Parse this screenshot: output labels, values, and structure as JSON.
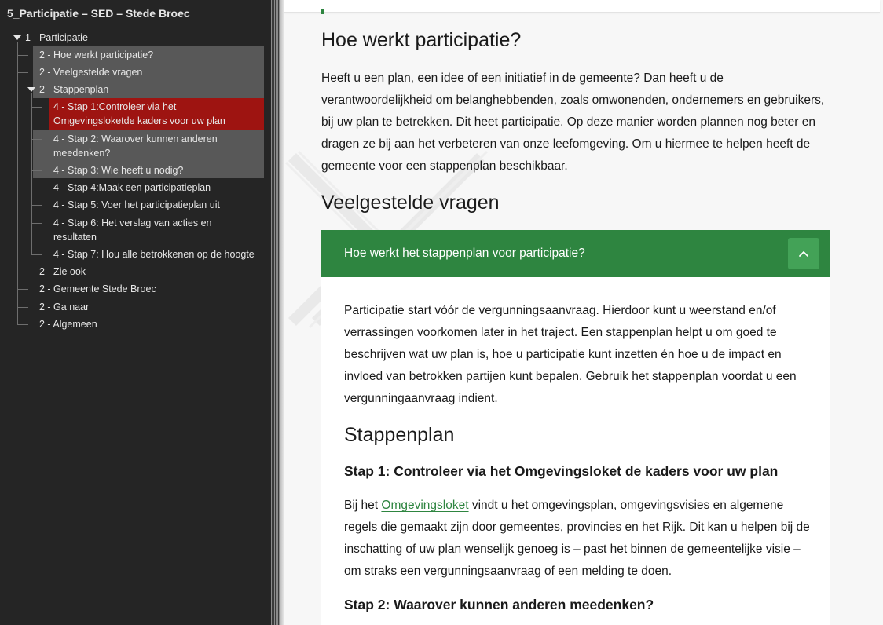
{
  "sidebar": {
    "title": "5_Participatie – SED – Stede Broec",
    "items": [
      {
        "label": "1 - Participatie"
      },
      {
        "label": "2 - Hoe werkt participatie?"
      },
      {
        "label": "2 - Veelgestelde vragen"
      },
      {
        "label": "2 - Stappenplan"
      },
      {
        "label": "4 - Stap 1:Controleer via het Omgevingsloketde kaders voor uw plan"
      },
      {
        "label": "4 - Stap 2: Waarover kunnen anderen meedenken?"
      },
      {
        "label": "4 - Stap 3: Wie heeft u nodig?"
      },
      {
        "label": "4 - Stap 4:Maak een participatieplan"
      },
      {
        "label": "4 - Stap 5: Voer het participatieplan uit"
      },
      {
        "label": "4 - Stap 6: Het verslag van acties en resultaten"
      },
      {
        "label": "4 - Stap 7: Hou alle betrokkenen op de hoogte"
      },
      {
        "label": "2 - Zie ook"
      },
      {
        "label": "2 - Gemeente Stede Broec"
      },
      {
        "label": "2 - Ga naar"
      },
      {
        "label": "2 - Algemeen"
      }
    ]
  },
  "content": {
    "heading1": "Hoe werkt participatie?",
    "intro": "Heeft u een plan, een idee of een initiatief in de gemeente? Dan heeft u de verantwoordelijkheid om belanghebbenden, zoals omwonenden, ondernemers en gebruikers, bij uw plan te betrekken. Dit heet participatie. Op deze manier worden plannen nog beter en dragen ze bij aan het verbeteren van onze leefomgeving. Om u hiermee te helpen heeft de gemeente voor een stappenplan beschikbaar.",
    "heading2": "Veelgestelde vragen",
    "accordion": {
      "title": "Hoe werkt het stappenplan voor participatie?",
      "paragraph": "Participatie start vóór de vergunningsaanvraag. Hierdoor kunt u weerstand en/of verrassingen voorkomen later in het traject. Een stappenplan helpt u om goed te beschrijven wat uw plan is, hoe u participatie kunt inzetten én hoe u de impact en invloed van betrokken partijen kunt bepalen. Gebruik het stappenplan voordat u een vergunningaanvraag indient.",
      "subheading": "Stappenplan",
      "step1_title": "Stap 1: Controleer via het Omgevingsloket de kaders voor uw plan",
      "step1_before": "Bij het",
      "step1_link": "Omgevingsloket",
      "step1_after": "vindt u het omgevingsplan, omgevingsvisies en algemene regels die gemaakt zijn door gemeentes, provincies en het Rijk. Dit kan u helpen bij de inschatting of uw plan wenselijk genoeg is – past het binnen de gemeentelijke visie – om straks een vergunningsaanvraag of een melding te doen.",
      "step2_title": "Stap 2: Waarover kunnen anderen meedenken?"
    }
  },
  "colors": {
    "sidebar_bg": "#252525",
    "selected_bg": "#9e1411",
    "highlight_bg": "#585858",
    "accent_green": "#2e8540",
    "toggle_green": "#43a257"
  },
  "icons": {
    "expanded": "triangle-down-icon",
    "accordion_toggle": "chevron-up-icon"
  }
}
